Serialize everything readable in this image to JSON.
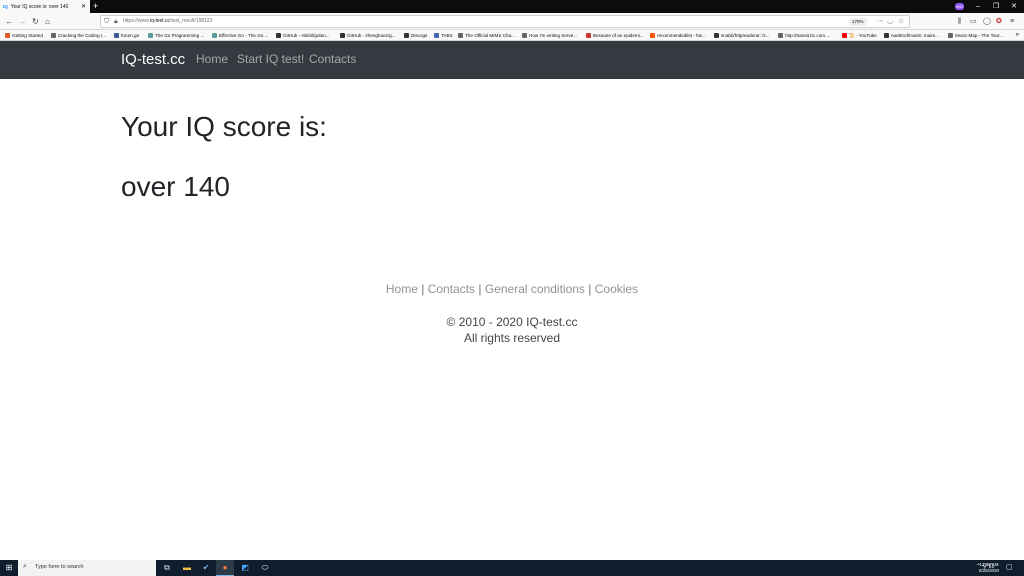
{
  "browser": {
    "tab_title": "Your IQ score is: over 140",
    "tab_favicon": "IQ",
    "new_tab_label": "+",
    "profile_label": "WO",
    "url_prefix": "https://www.",
    "url_domain": "iq-test.cc",
    "url_path": "/test_result/198122",
    "zoom": "170%",
    "bookmarks": [
      {
        "label": "Getting Started",
        "color": "#e25822"
      },
      {
        "label": "Cracking the Coding I...",
        "color": "#666666"
      },
      {
        "label": "forum.ge",
        "color": "#3a5a99"
      },
      {
        "label": "The Go Programming ...",
        "color": "#5f9ea0"
      },
      {
        "label": "Effective Go - The Go ...",
        "color": "#5f9ea0"
      },
      {
        "label": "GitHub - Aiikhil/golan...",
        "color": "#333333"
      },
      {
        "label": "GitHub - zhenghaoz/g...",
        "color": "#333333"
      },
      {
        "label": "Discogs",
        "color": "#333333"
      },
      {
        "label": "TABS",
        "color": "#4466aa"
      },
      {
        "label": "The Official MIMS Cha...",
        "color": "#666666"
      },
      {
        "label": "How I'm writing Serve...",
        "color": "#666666"
      },
      {
        "label": "Because of an epidemi...",
        "color": "#cc3333"
      },
      {
        "label": "recommendedlist - his...",
        "color": "#ff5500"
      },
      {
        "label": "snabb/httpreaderat: G...",
        "color": "#333333"
      },
      {
        "label": "http://transit.ttc.com....",
        "color": "#666666"
      },
      {
        "label": "📜 - YouTube",
        "color": "#ff0000"
      },
      {
        "label": "naebtrof/maimi: maim...",
        "color": "#333333"
      },
      {
        "label": "Music-Map - The Tour...",
        "color": "#666666"
      }
    ]
  },
  "site": {
    "brand": "IQ-test.cc",
    "nav": [
      "Home",
      "Start IQ test!",
      "Contacts"
    ]
  },
  "main": {
    "heading": "Your IQ score is:",
    "score": "over 140"
  },
  "footer": {
    "links": [
      "Home",
      "Contacts",
      "General conditions",
      "Cookies"
    ],
    "separator": "|",
    "copyright": "© 2010 - 2020 IQ-test.cc",
    "rights": "All rights reserved"
  },
  "taskbar": {
    "search_placeholder": "Type here to search",
    "time": "12:36 AM",
    "date": "8/26/2020"
  }
}
